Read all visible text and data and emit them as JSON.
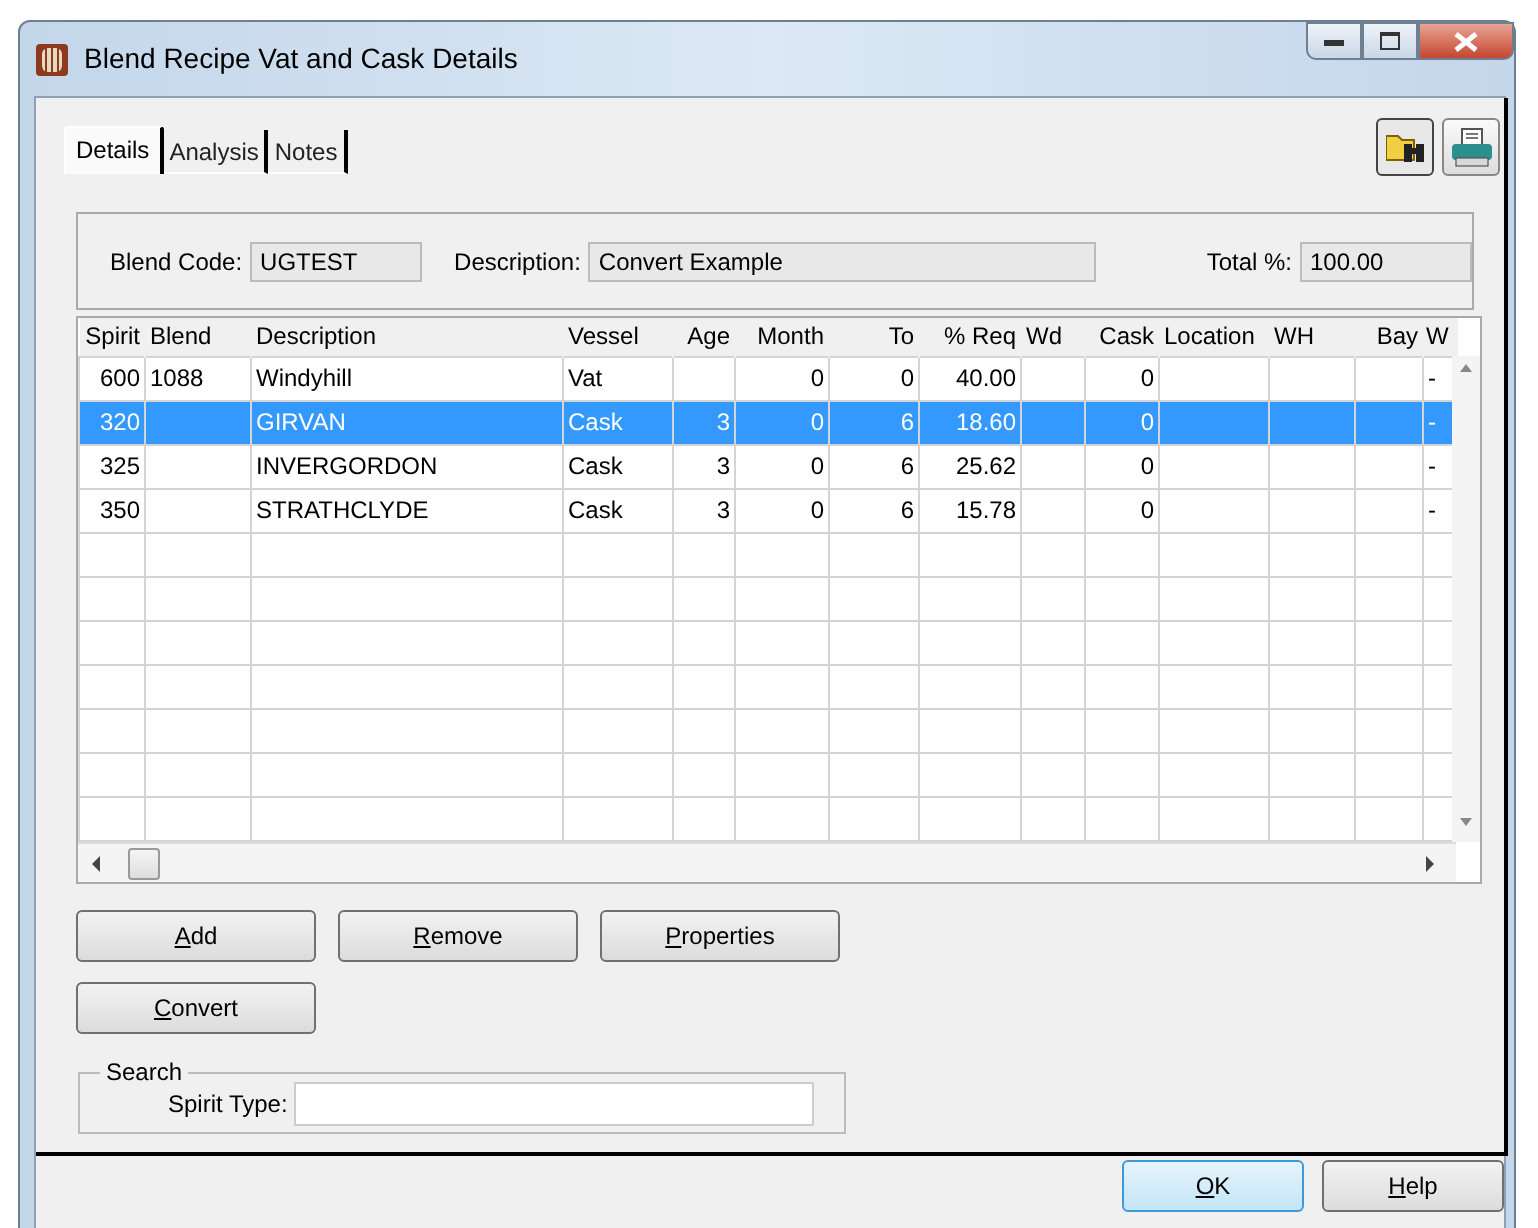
{
  "window": {
    "title": "Blend Recipe Vat and Cask Details"
  },
  "tabs": [
    {
      "label": "Details",
      "selected": true
    },
    {
      "label": "Analysis",
      "selected": false
    },
    {
      "label": "Notes",
      "selected": false
    }
  ],
  "header": {
    "blend_code_label": "Blend Code:",
    "blend_code": "UGTEST",
    "description_label": "Description:",
    "description": "Convert Example",
    "total_label": "Total %:",
    "total": "100.00"
  },
  "table": {
    "columns": [
      {
        "label": "Spirit",
        "kind": "number"
      },
      {
        "label": "Blend",
        "kind": "text"
      },
      {
        "label": "Description",
        "kind": "text"
      },
      {
        "label": "Vessel",
        "kind": "text"
      },
      {
        "label": "Age",
        "kind": "number"
      },
      {
        "label": "Month",
        "kind": "number"
      },
      {
        "label": "To",
        "kind": "number"
      },
      {
        "label": "% Req",
        "kind": "number"
      },
      {
        "label": "Wd",
        "kind": "text"
      },
      {
        "label": "Cask",
        "kind": "number"
      },
      {
        "label": "Location",
        "kind": "text"
      },
      {
        "label": "WH",
        "kind": "text"
      },
      {
        "label": "Bay",
        "kind": "number"
      },
      {
        "label": "W",
        "kind": "text"
      }
    ],
    "rows": [
      {
        "selected": false,
        "cells": [
          "600",
          "1088",
          "Windyhill",
          "Vat",
          "",
          "0",
          "0",
          "40.00",
          "",
          "0",
          "",
          "",
          "",
          "-"
        ]
      },
      {
        "selected": true,
        "cells": [
          "320",
          "",
          "GIRVAN",
          "Cask",
          "3",
          "0",
          "6",
          "18.60",
          "",
          "0",
          "",
          "",
          "",
          "-"
        ]
      },
      {
        "selected": false,
        "cells": [
          "325",
          "",
          "INVERGORDON",
          "Cask",
          "3",
          "0",
          "6",
          "25.62",
          "",
          "0",
          "",
          "",
          "",
          "-"
        ]
      },
      {
        "selected": false,
        "cells": [
          "350",
          "",
          "STRATHCLYDE",
          "Cask",
          "3",
          "0",
          "6",
          "15.78",
          "",
          "0",
          "",
          "",
          "",
          "-"
        ]
      }
    ]
  },
  "buttons": [
    {
      "label": "Add"
    },
    {
      "label": "Remove"
    },
    {
      "label": "Properties"
    }
  ],
  "convert_button": {
    "label": "Convert"
  },
  "search": {
    "legend": "Search",
    "label": "Spirit Type:"
  },
  "footer_buttons": [
    {
      "label": "OK",
      "default": true
    },
    {
      "label": "Help",
      "default": false
    }
  ]
}
